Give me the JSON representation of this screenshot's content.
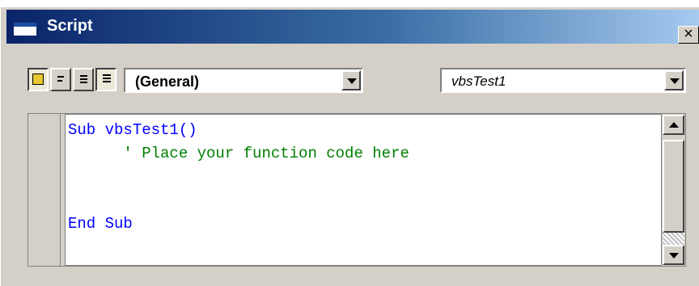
{
  "window": {
    "title": "Script",
    "close_label": "×"
  },
  "toolbar": {
    "buttons": [
      {
        "name": "script-view-button",
        "icon": "scroll-icon",
        "pressed": true
      },
      {
        "name": "align-left-button",
        "icon": "align-left-icon"
      },
      {
        "name": "align-right-button",
        "icon": "align-right-icon"
      },
      {
        "name": "justify-button",
        "icon": "justify-icon"
      }
    ],
    "object_combo": {
      "value": "(General)"
    },
    "procedure_combo": {
      "value": "vbsTest1"
    }
  },
  "editor": {
    "lines": [
      {
        "text": "Sub vbsTest1()",
        "kind": "keyword"
      },
      {
        "text": "      ' Place your function code here",
        "kind": "comment"
      },
      {
        "text": "",
        "kind": "plain"
      },
      {
        "text": "",
        "kind": "plain"
      },
      {
        "text": "End Sub",
        "kind": "keyword"
      }
    ]
  },
  "colors": {
    "titlebar_start": "#0a246a",
    "titlebar_end": "#a6caf0",
    "keyword": "#0000ff",
    "comment": "#008000",
    "face": "#d4d0c8"
  }
}
